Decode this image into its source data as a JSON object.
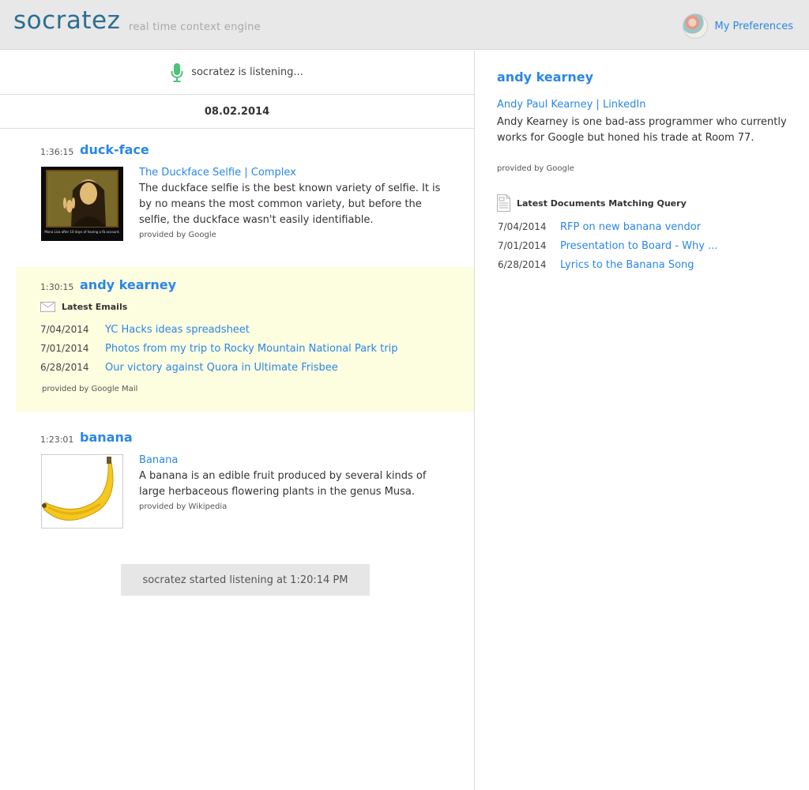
{
  "header": {
    "logo": "socratez",
    "tagline": "real time context engine",
    "preferences_label": "My Preferences"
  },
  "status": {
    "listening_text": "socratez is listening...",
    "date": "08.02.2014",
    "started_text": "socratez started listening at 1:20:14 PM"
  },
  "feed": [
    {
      "time": "1:36:15",
      "term": "duck-face",
      "thumbnail_caption": "Mona Lisa after 10 days of having a fb account.",
      "result_title": "The Duckface Selfie | Complex",
      "result_desc": "The duckface selfie is the best known variety of selfie. It is by no means the most common variety, but before the selfie, the duckface wasn't easily identifiable.",
      "provider": "provided by Google"
    },
    {
      "time": "1:30:15",
      "term": "andy kearney",
      "section_label": "Latest Emails",
      "emails": [
        {
          "date": "7/04/2014",
          "subject": "YC Hacks ideas spreadsheet"
        },
        {
          "date": "7/01/2014",
          "subject": "Photos from my trip to Rocky Mountain National Park trip"
        },
        {
          "date": "6/28/2014",
          "subject": "Our victory against Quora in Ultimate Frisbee"
        }
      ],
      "provider": "provided by Google Mail"
    },
    {
      "time": "1:23:01",
      "term": "banana",
      "result_title": "Banana",
      "result_desc": "A banana is an edible fruit produced by several kinds of large herbaceous flowering plants in the genus Musa.",
      "provider": "provided by Wikipedia"
    }
  ],
  "detail": {
    "title": "andy kearney",
    "link": "Andy Paul Kearney | LinkedIn",
    "desc": "Andy Kearney is one bad-ass programmer who currently works for Google but honed his trade at Room 77.",
    "provider": "provided by Google",
    "docs_label": "Latest Documents Matching Query",
    "docs": [
      {
        "date": "7/04/2014",
        "title": "RFP on new banana vendor"
      },
      {
        "date": "7/01/2014",
        "title": "Presentation to Board - Why ..."
      },
      {
        "date": "6/28/2014",
        "title": "Lyrics to the Banana Song"
      }
    ]
  },
  "colors": {
    "accent": "#2a86e8",
    "logo": "#2d6e93",
    "highlight": "#fdfde0",
    "header_bg": "#e8e8e8",
    "mic": "#4cc27a"
  },
  "icons": [
    "microphone-icon",
    "envelope-icon",
    "document-icon",
    "avatar"
  ]
}
